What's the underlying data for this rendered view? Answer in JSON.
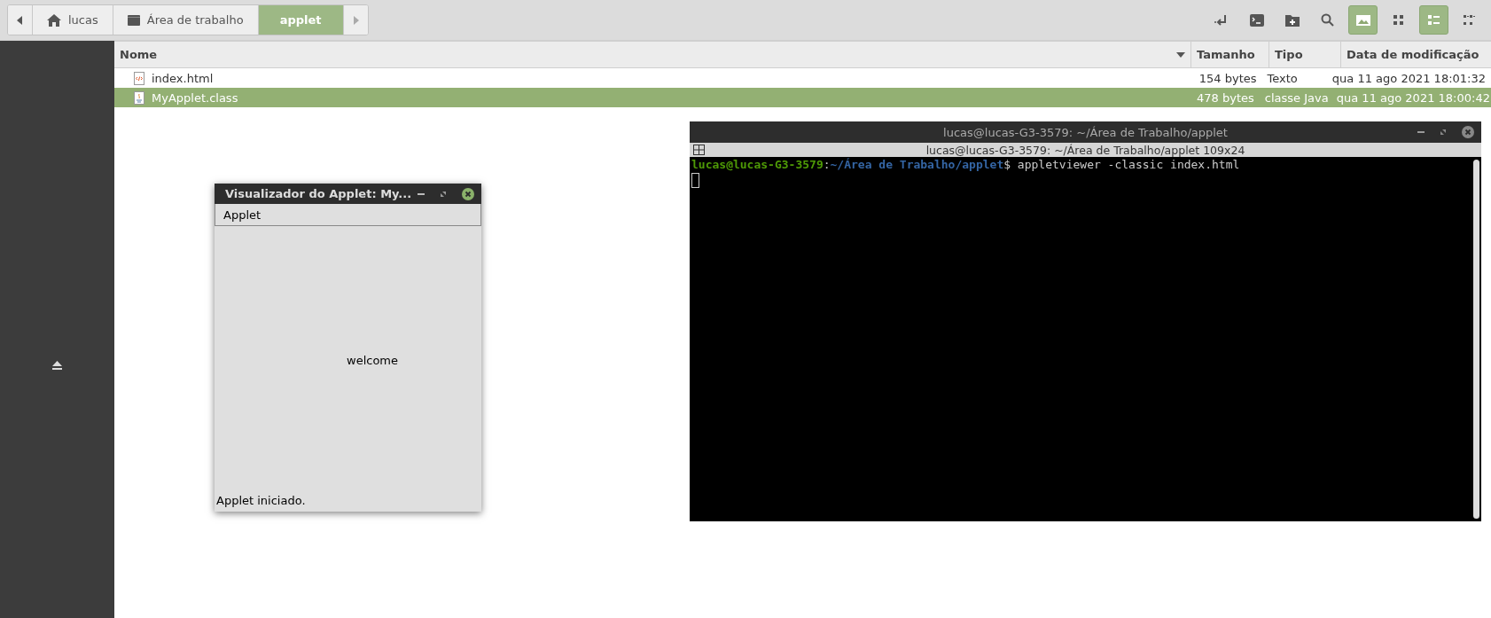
{
  "toolbar": {
    "breadcrumb": [
      {
        "label": "lucas",
        "kind": "home",
        "selected": false
      },
      {
        "label": "Área de trabalho",
        "kind": "folder",
        "selected": false
      },
      {
        "label": "applet",
        "kind": "plain",
        "selected": true
      }
    ],
    "buttons": [
      {
        "kind": "open-terminal-arrow",
        "selected": false
      },
      {
        "kind": "terminal",
        "selected": false
      },
      {
        "kind": "new-folder",
        "selected": false
      },
      {
        "kind": "search",
        "selected": false
      },
      {
        "kind": "thumbnails",
        "selected": true
      },
      {
        "kind": "icon-view",
        "selected": false
      },
      {
        "kind": "list-view",
        "selected": true
      },
      {
        "kind": "compact-view",
        "selected": false
      }
    ]
  },
  "table": {
    "columns": [
      "Nome",
      "Tamanho",
      "Tipo",
      "Data de modificação"
    ],
    "rows": [
      {
        "kind": "html",
        "name": "index.html",
        "size": "154 bytes",
        "type": "Texto",
        "modified": "qua 11 ago 2021 18:01:32",
        "selected": false
      },
      {
        "kind": "java",
        "name": "MyApplet.class",
        "size": "478 bytes",
        "type": "classe Java",
        "modified": "qua 11 ago 2021 18:00:42",
        "selected": true
      }
    ]
  },
  "applet_window": {
    "title": "Visualizador do Applet: My...",
    "menu": "Applet",
    "content": "welcome",
    "status": "Applet iniciado."
  },
  "terminal": {
    "title": "lucas@lucas-G3-3579: ~/Área de Trabalho/applet",
    "tab_title": "lucas@lucas-G3-3579: ~/Área de Trabalho/applet 109x24",
    "user_host": "lucas@lucas-G3-3579",
    "separator": ":",
    "path": "~/Área de Trabalho/applet",
    "prompt_sign": "$",
    "command": " appletviewer -classic index.html"
  }
}
